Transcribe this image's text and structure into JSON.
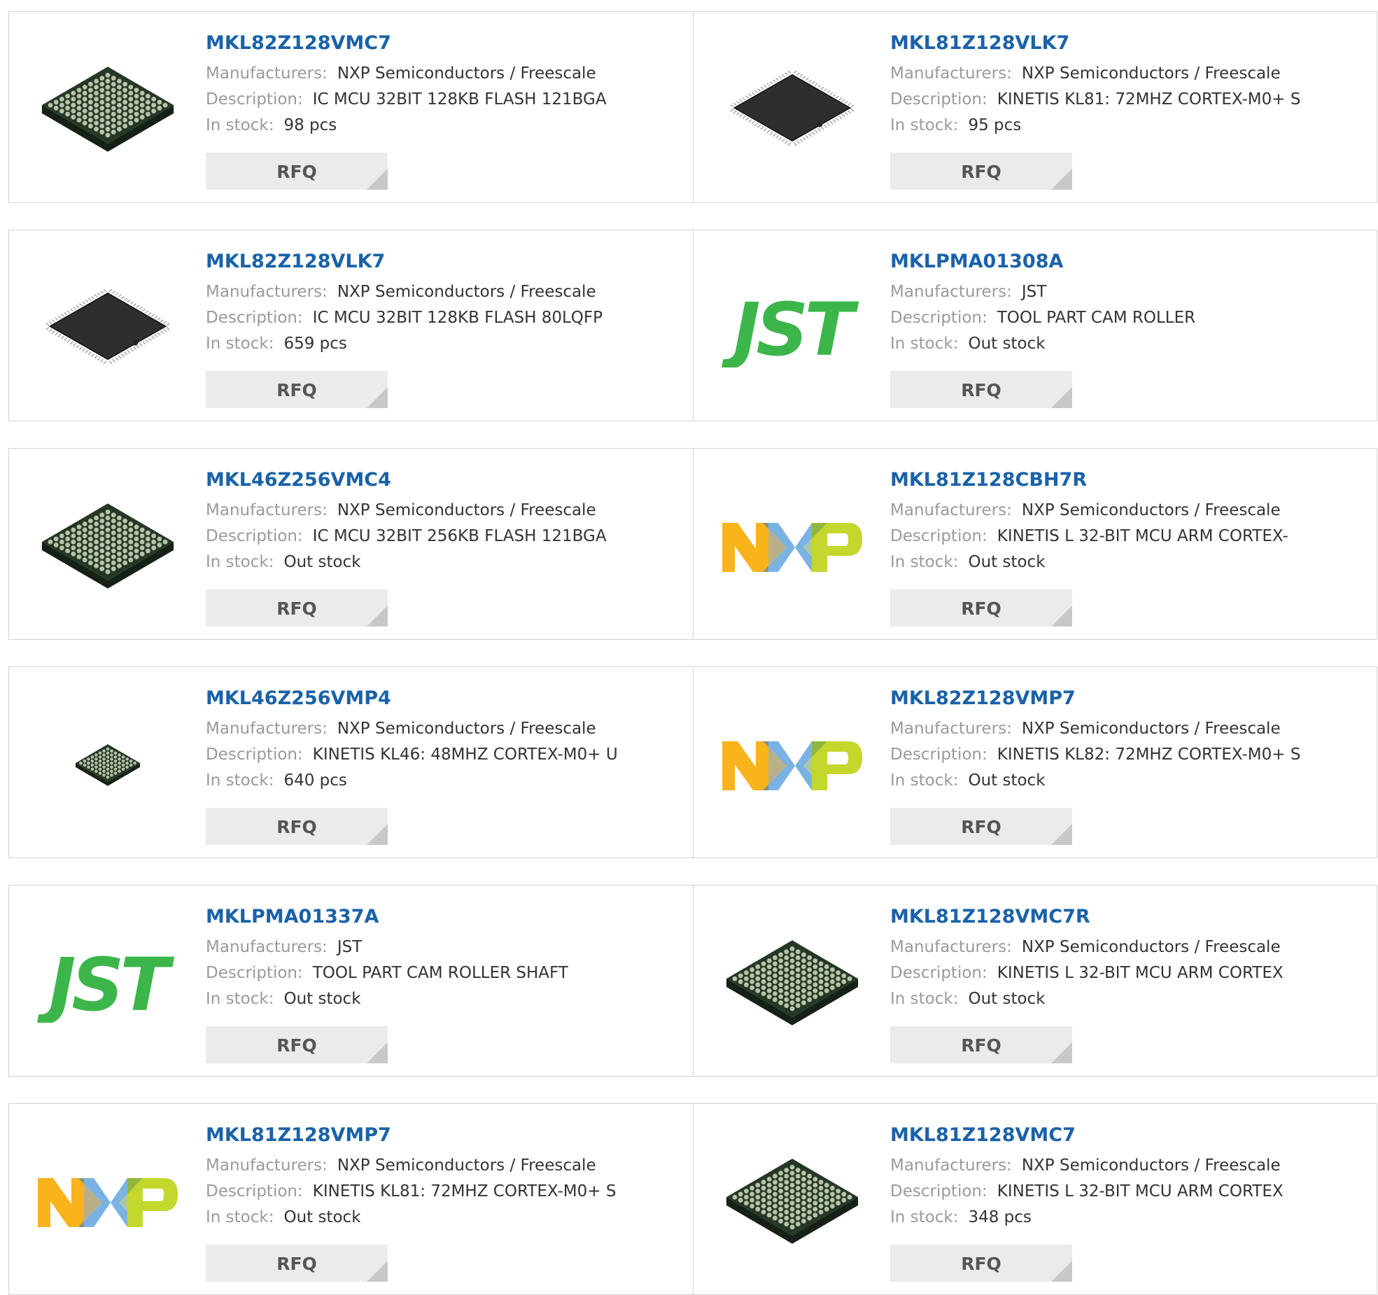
{
  "labels": {
    "manufacturers": "Manufacturers:",
    "description": "Description:",
    "stock": "In stock:",
    "rfq": "RFQ"
  },
  "products": [
    {
      "part": "MKL82Z128VMC7",
      "manufacturer": "NXP Semiconductors / Freescale",
      "description": "IC MCU 32BIT 128KB FLASH 121BGA",
      "stock": "98 pcs",
      "image": "bga-chip"
    },
    {
      "part": "MKL81Z128VLK7",
      "manufacturer": "NXP Semiconductors / Freescale",
      "description": "KINETIS KL81: 72MHZ CORTEX-M0+ S",
      "stock": "95 pcs",
      "image": "lqfp-chip"
    },
    {
      "part": "MKL82Z128VLK7",
      "manufacturer": "NXP Semiconductors / Freescale",
      "description": "IC MCU 32BIT 128KB FLASH 80LQFP",
      "stock": "659 pcs",
      "image": "lqfp-chip"
    },
    {
      "part": "MKLPMA01308A",
      "manufacturer": "JST",
      "description": "TOOL PART CAM ROLLER",
      "stock": "Out stock",
      "image": "jst-logo"
    },
    {
      "part": "MKL46Z256VMC4",
      "manufacturer": "NXP Semiconductors / Freescale",
      "description": "IC MCU 32BIT 256KB FLASH 121BGA",
      "stock": "Out stock",
      "image": "bga-chip"
    },
    {
      "part": "MKL81Z128CBH7R",
      "manufacturer": "NXP Semiconductors / Freescale",
      "description": "KINETIS L 32-BIT MCU ARM CORTEX-",
      "stock": "Out stock",
      "image": "nxp-logo"
    },
    {
      "part": "MKL46Z256VMP4",
      "manufacturer": "NXP Semiconductors / Freescale",
      "description": "KINETIS KL46: 48MHZ CORTEX-M0+ U",
      "stock": "640 pcs",
      "image": "small-bga-chip"
    },
    {
      "part": "MKL82Z128VMP7",
      "manufacturer": "NXP Semiconductors / Freescale",
      "description": "KINETIS KL82: 72MHZ CORTEX-M0+ S",
      "stock": "Out stock",
      "image": "nxp-logo"
    },
    {
      "part": "MKLPMA01337A",
      "manufacturer": "JST",
      "description": "TOOL PART CAM ROLLER SHAFT",
      "stock": "Out stock",
      "image": "jst-logo"
    },
    {
      "part": "MKL81Z128VMC7R",
      "manufacturer": "NXP Semiconductors / Freescale",
      "description": "KINETIS L 32-BIT MCU ARM CORTEX",
      "stock": "Out stock",
      "image": "bga-chip"
    },
    {
      "part": "MKL81Z128VMP7",
      "manufacturer": "NXP Semiconductors / Freescale",
      "description": "KINETIS KL81: 72MHZ CORTEX-M0+ S",
      "stock": "Out stock",
      "image": "nxp-logo"
    },
    {
      "part": "MKL81Z128VMC7",
      "manufacturer": "NXP Semiconductors / Freescale",
      "description": "KINETIS L 32-BIT MCU ARM CORTEX",
      "stock": "348 pcs",
      "image": "bga-chip"
    }
  ],
  "jst_logo_text": "JST",
  "colors": {
    "part_link": "#1a62a8",
    "label": "#9a9a9a",
    "value": "#333333",
    "border": "#d3d3d3",
    "rfq_bg": "#ebebeb",
    "jst_green": "#3cb54a",
    "nxp_orange": "#f9b31b",
    "nxp_blue": "#7ab3e3",
    "nxp_green": "#c4d72d",
    "chip_body": "#253826"
  }
}
